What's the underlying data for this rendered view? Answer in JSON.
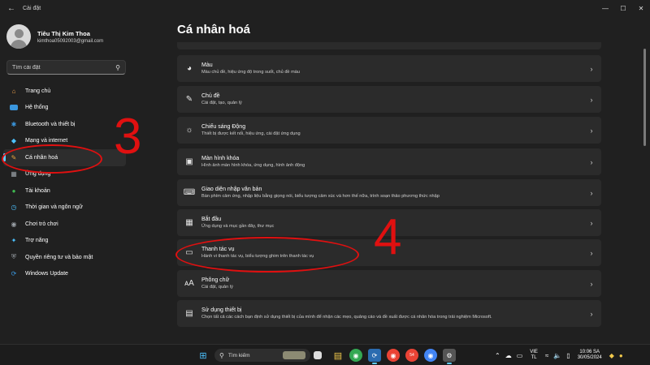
{
  "window": {
    "title": "Cài đặt",
    "back_glyph": "←",
    "minimize_glyph": "—",
    "maximize_glyph": "☐",
    "close_glyph": "✕"
  },
  "profile": {
    "name": "Tiêu Thị Kim Thoa",
    "email": "kimthoa05092003@gmail.com"
  },
  "search": {
    "placeholder": "Tìm cài đặt",
    "icon": "search-icon"
  },
  "nav": {
    "items": [
      {
        "label": "Trang chủ",
        "icon": "home-icon",
        "color": "#f0a04b"
      },
      {
        "label": "Hệ thống",
        "icon": "monitor-icon",
        "color": "#3a96dd"
      },
      {
        "label": "Bluetooth và thiết bị",
        "icon": "bluetooth-icon",
        "color": "#3a96dd"
      },
      {
        "label": "Mạng và internet",
        "icon": "wifi-icon",
        "color": "#4cc2ff"
      },
      {
        "label": "Cá nhân hoá",
        "icon": "brush-icon",
        "color": "#e8a33c"
      },
      {
        "label": "Ứng dụng",
        "icon": "apps-icon",
        "color": "#9aa0a6"
      },
      {
        "label": "Tài khoản",
        "icon": "account-icon",
        "color": "#3fb950"
      },
      {
        "label": "Thời gian và ngôn ngữ",
        "icon": "globe-clock-icon",
        "color": "#4cc2ff"
      },
      {
        "label": "Chơi trò chơi",
        "icon": "gamepad-icon",
        "color": "#9aa0a6"
      },
      {
        "label": "Trợ năng",
        "icon": "accessibility-icon",
        "color": "#4cc2ff"
      },
      {
        "label": "Quyền riêng tư và bảo mật",
        "icon": "shield-icon",
        "color": "#9aa0a6"
      },
      {
        "label": "Windows Update",
        "icon": "update-icon",
        "color": "#3a96dd"
      }
    ],
    "active_index": 4
  },
  "main": {
    "title": "Cá nhân hoá",
    "cards": [
      {
        "title": "Màu",
        "desc": "Màu chủ đề, hiệu ứng độ trong suốt, chủ đề màu",
        "icon": "palette-icon"
      },
      {
        "title": "Chủ đề",
        "desc": "Cài đặt, tạo, quản lý",
        "icon": "pen-icon"
      },
      {
        "title": "Chiếu sáng Động",
        "desc": "Thiết bị được kết nối, hiệu ứng, cài đặt ứng dụng",
        "icon": "lighting-icon"
      },
      {
        "title": "Màn hình khóa",
        "desc": "Hình ảnh màn hình khóa, ứng dụng, hình ảnh động",
        "icon": "lock-screen-icon"
      },
      {
        "title": "Giao diện nhập văn bản",
        "desc": "Bàn phím cảm ứng, nhập liệu bằng giọng nói, biểu tượng cảm xúc và hơn thế nữa, trình soạn thảo phương thức nhập",
        "icon": "keyboard-icon"
      },
      {
        "title": "Bắt đầu",
        "desc": "Ứng dụng và mục gần đây, thư mục",
        "icon": "start-icon"
      },
      {
        "title": "Thanh tác vụ",
        "desc": "Hành vi thanh tác vụ, biểu tượng ghim trên thanh tác vụ",
        "icon": "taskbar-icon"
      },
      {
        "title": "Phông chữ",
        "desc": "Cài đặt, quản lý",
        "icon": "font-icon"
      },
      {
        "title": "Sử dụng thiết bị",
        "desc": "Chọn tất cả các cách bạn định sử dụng thiết bị của mình để nhận các mẹo, quảng cáo và đề xuất được cá nhân hóa trong trải nghiệm Microsoft.",
        "icon": "device-usage-icon"
      }
    ]
  },
  "annotations": {
    "step_sidebar": "3",
    "step_card": "4",
    "color": "#e01010"
  },
  "taskbar": {
    "search_label": "Tìm kiếm",
    "language_top": "VIE",
    "language_bottom": "TL",
    "time": "10:06 SA",
    "date": "30/05/2024",
    "badge_count": "54"
  },
  "colors": {
    "accent": "#60cdff",
    "background": "#202020",
    "card": "#2b2b2b"
  }
}
